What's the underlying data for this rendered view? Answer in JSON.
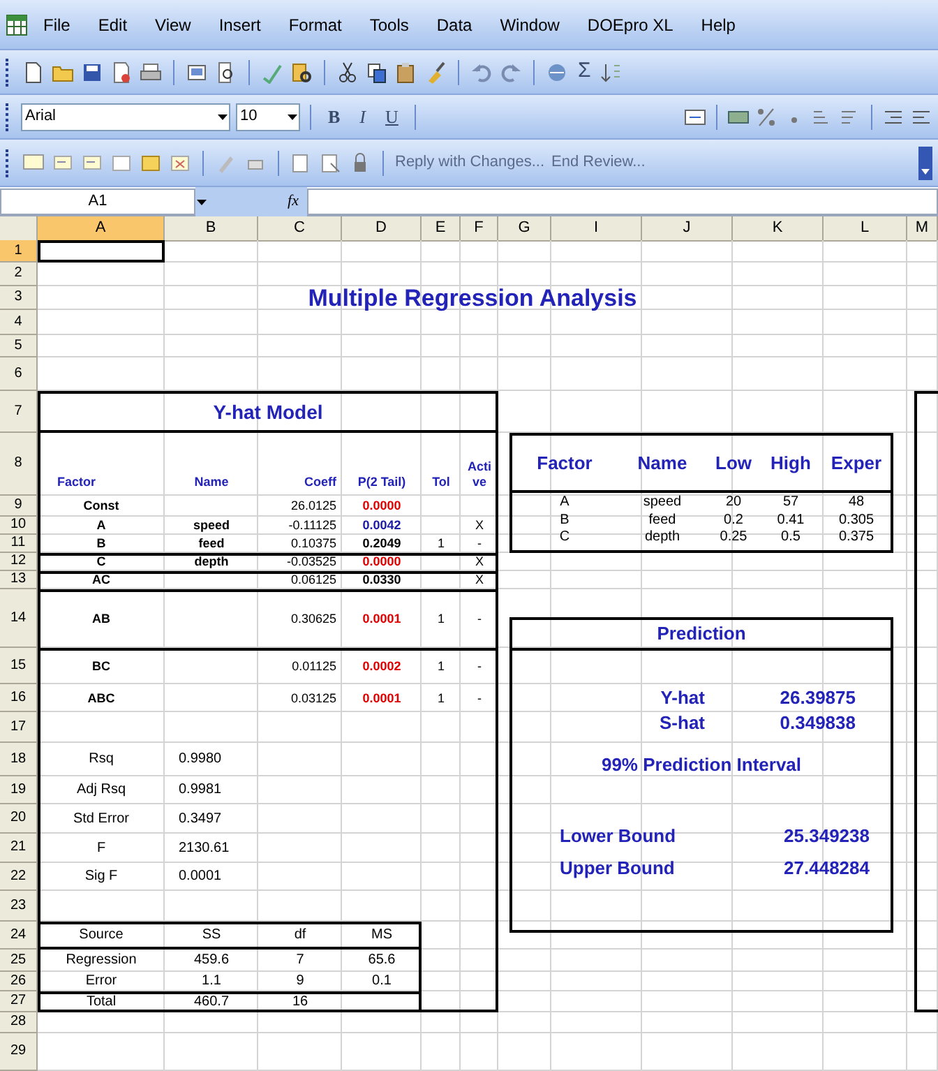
{
  "menu": [
    "File",
    "Edit",
    "View",
    "Insert",
    "Format",
    "Tools",
    "Data",
    "Window",
    "DOEpro XL",
    "Help"
  ],
  "toolbar": {
    "autosum": "Σ"
  },
  "formatting": {
    "font": "Arial",
    "size": "10",
    "bold": "B",
    "italic": "I",
    "underline": "U"
  },
  "reviewing": {
    "reply": "Reply with Changes...",
    "end_review": "End Review..."
  },
  "formula_bar": {
    "name_box": "A1",
    "fx": "fx"
  },
  "sheet": {
    "column_headers": [
      {
        "label": "A",
        "selected": true
      },
      {
        "label": "B",
        "selected": false
      },
      {
        "label": "C",
        "selected": false
      },
      {
        "label": "D",
        "selected": false
      },
      {
        "label": "E",
        "selected": false
      },
      {
        "label": "F",
        "selected": false
      },
      {
        "label": "G",
        "selected": false
      },
      {
        "label": "I",
        "selected": false
      },
      {
        "label": "J",
        "selected": false
      },
      {
        "label": "K",
        "selected": false
      },
      {
        "label": "L",
        "selected": false
      },
      {
        "label": "M",
        "selected": false
      }
    ],
    "row_numbers": [
      {
        "label": "1",
        "selected": true
      },
      {
        "label": "2",
        "selected": false
      },
      {
        "label": "3",
        "selected": false
      },
      {
        "label": "4",
        "selected": false
      },
      {
        "label": "5",
        "selected": false
      },
      {
        "label": "6",
        "selected": false
      },
      {
        "label": "7",
        "selected": false
      },
      {
        "label": "8",
        "selected": false
      },
      {
        "label": "9",
        "selected": false
      },
      {
        "label": "10",
        "selected": false
      },
      {
        "label": "11",
        "selected": false
      },
      {
        "label": "12",
        "selected": false
      },
      {
        "label": "13",
        "selected": false
      },
      {
        "label": "14",
        "selected": false
      },
      {
        "label": "15",
        "selected": false
      },
      {
        "label": "16",
        "selected": false
      },
      {
        "label": "17",
        "selected": false
      },
      {
        "label": "18",
        "selected": false
      },
      {
        "label": "19",
        "selected": false
      },
      {
        "label": "20",
        "selected": false
      },
      {
        "label": "21",
        "selected": false
      },
      {
        "label": "22",
        "selected": false
      },
      {
        "label": "23",
        "selected": false
      },
      {
        "label": "24",
        "selected": false
      },
      {
        "label": "25",
        "selected": false
      },
      {
        "label": "26",
        "selected": false
      },
      {
        "label": "27",
        "selected": false
      },
      {
        "label": "28",
        "selected": false
      },
      {
        "label": "29",
        "selected": false
      }
    ],
    "title": "Multiple Regression Analysis",
    "model": {
      "title": "Y-hat Model",
      "columns": [
        "Factor",
        "Name",
        "Coeff",
        "P(2 Tail)",
        "Tol",
        "Active"
      ],
      "rows": [
        {
          "factor": "Const",
          "coeff": "26.0125",
          "p": "0.0000",
          "color": "#e00000"
        },
        {
          "factor": "A",
          "name": "speed",
          "coeff": "-0.11125",
          "p": "0.0042",
          "color": "#1a1aa6",
          "active": "X"
        },
        {
          "factor": "B",
          "name": "feed",
          "coeff": "0.10375",
          "p": "0.2049",
          "color": "#000000",
          "tol": "1",
          "active": "-"
        },
        {
          "factor": "C",
          "name": "depth",
          "coeff": "-0.03525",
          "p": "0.0000",
          "color": "#e00000",
          "active": "X"
        },
        {
          "factor": "AC",
          "coeff": "0.06125",
          "p": "0.0330",
          "color": "#000000",
          "active": "X"
        },
        {
          "factor": "AB",
          "coeff": "0.30625",
          "p": "0.0001",
          "color": "#e00000",
          "tol": "1",
          "active": "-"
        },
        {
          "factor": "BC",
          "coeff": "0.01125",
          "p": "0.0002",
          "color": "#e00000",
          "tol": "1",
          "active": "-"
        },
        {
          "factor": "ABC",
          "coeff": "0.03125",
          "p": "0.0001",
          "color": "#e00000",
          "tol": "1",
          "active": "-"
        }
      ]
    },
    "stats": [
      {
        "label": "Rsq",
        "value": "0.9980"
      },
      {
        "label": "Adj Rsq",
        "value": "0.9981"
      },
      {
        "label": "Std Error",
        "value": "0.3497"
      },
      {
        "label": "F",
        "value": "2130.61"
      },
      {
        "label": "Sig F",
        "value": "0.0001"
      }
    ],
    "anova": {
      "columns": [
        "Source",
        "SS",
        "df",
        "MS"
      ],
      "rows": [
        [
          "Regression",
          "459.6",
          "7",
          "65.6"
        ],
        [
          "Error",
          "1.1",
          "9",
          "0.1"
        ],
        [
          "Total",
          "460.7",
          "16"
        ]
      ]
    },
    "factors": {
      "columns": [
        "Factor",
        "Name",
        "Low",
        "High",
        "Exper"
      ],
      "rows": [
        [
          "A",
          "speed",
          "20",
          "57",
          "48"
        ],
        [
          "B",
          "feed",
          "0.2",
          "0.41",
          "0.305"
        ],
        [
          "C",
          "depth",
          "0.25",
          "0.5",
          "0.375"
        ]
      ]
    },
    "prediction": {
      "title": "Prediction",
      "estimates": [
        {
          "label": "Y-hat",
          "value": "26.39875"
        },
        {
          "label": "S-hat",
          "value": "0.349838"
        }
      ],
      "interval_title": "99% Prediction Interval",
      "bounds": [
        {
          "label": "Lower Bound",
          "value": "25.349238"
        },
        {
          "label": "Upper Bound",
          "value": "27.448284"
        }
      ]
    }
  }
}
